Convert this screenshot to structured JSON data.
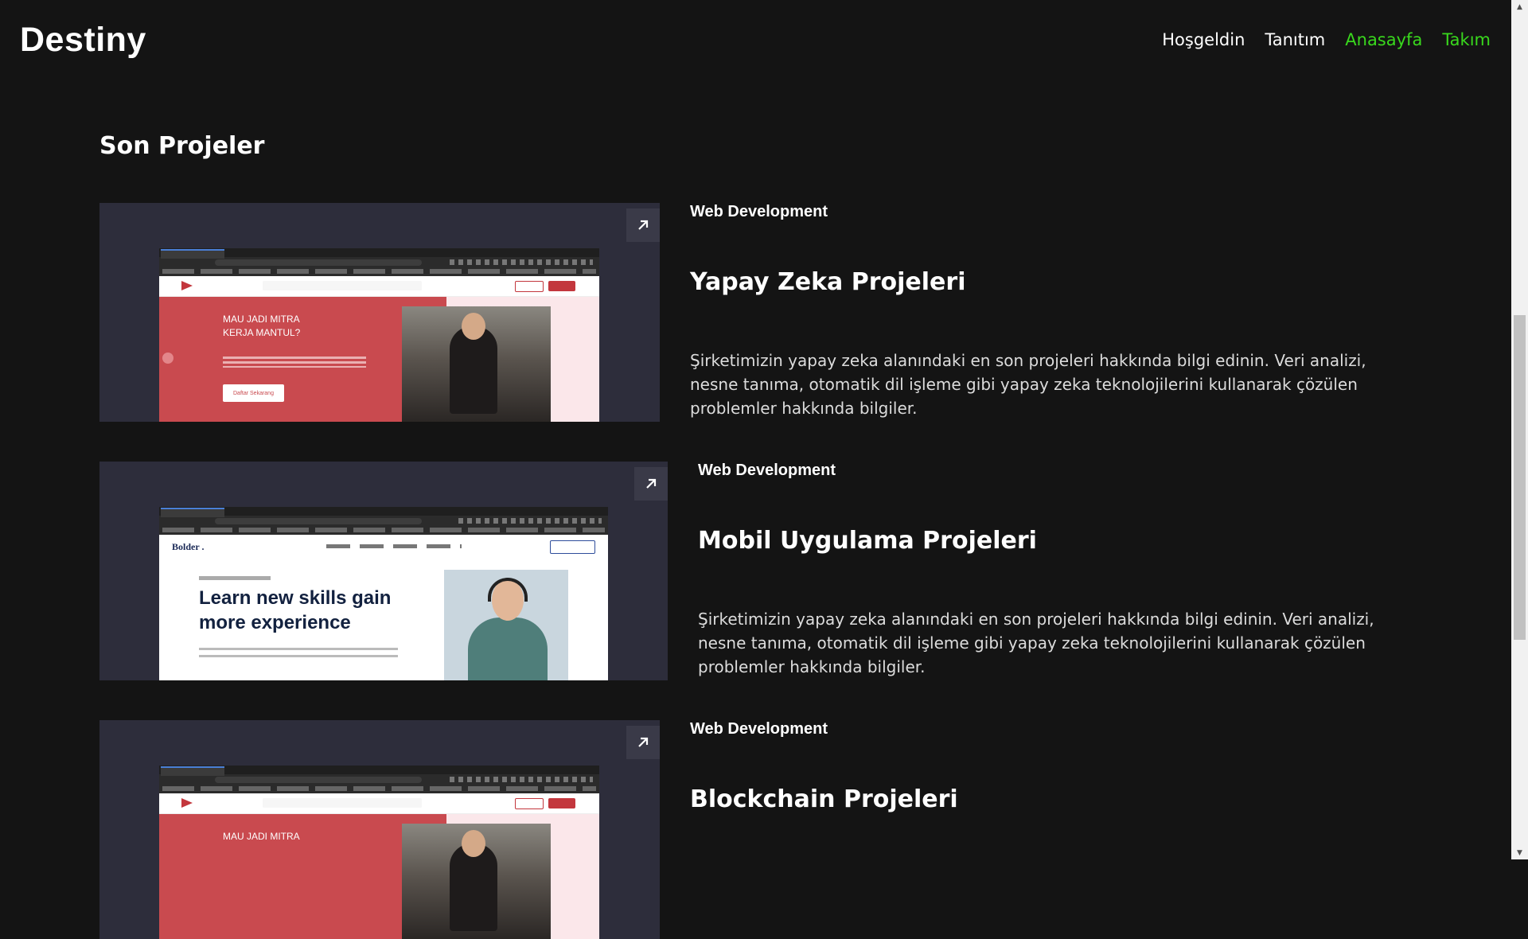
{
  "header": {
    "brand": "Destiny",
    "nav": [
      "Hoşgeldin",
      "Tanıtım",
      "Anasayfa",
      "Takım"
    ],
    "colors": {
      "active_green": "#39d81d",
      "background": "#141414",
      "card": "#2d2d3b"
    }
  },
  "section": {
    "title": "Son Projeler"
  },
  "projects": [
    {
      "category": "Web Development",
      "title": "Yapay Zeka Projeleri",
      "description": "Şirketimizin yapay zeka alanındaki en son projeleri hakkında bilgi edinin. Veri analizi, nesne tanıma, otomatik dil işleme gibi yapay zeka teknolojilerini kullanarak çözülen problemler hakkında bilgiler.",
      "preview": {
        "hero_line1": "MAU JADI MITRA",
        "hero_line2": "KERJA MANTUL?",
        "button": "Daftar Sekarang"
      }
    },
    {
      "category": "Web Development",
      "title": "Mobil Uygulama Projeleri",
      "description": "Şirketimizin yapay zeka alanındaki en son projeleri hakkında bilgi edinin. Veri analizi, nesne tanıma, otomatik dil işleme gibi yapay zeka teknolojilerini kullanarak çözülen problemler hakkında bilgiler.",
      "preview": {
        "logo": "Bolder .",
        "title_line1": "Learn new skills gain",
        "title_line2": "more experience"
      }
    },
    {
      "category": "Web Development",
      "title": "Blockchain Projeleri",
      "preview": {
        "hero_line1": "MAU JADI MITRA"
      }
    }
  ],
  "icons": {
    "open_link": "arrow-up-right-icon",
    "scroll_up": "triangle-up-icon",
    "scroll_down": "triangle-down-icon"
  }
}
